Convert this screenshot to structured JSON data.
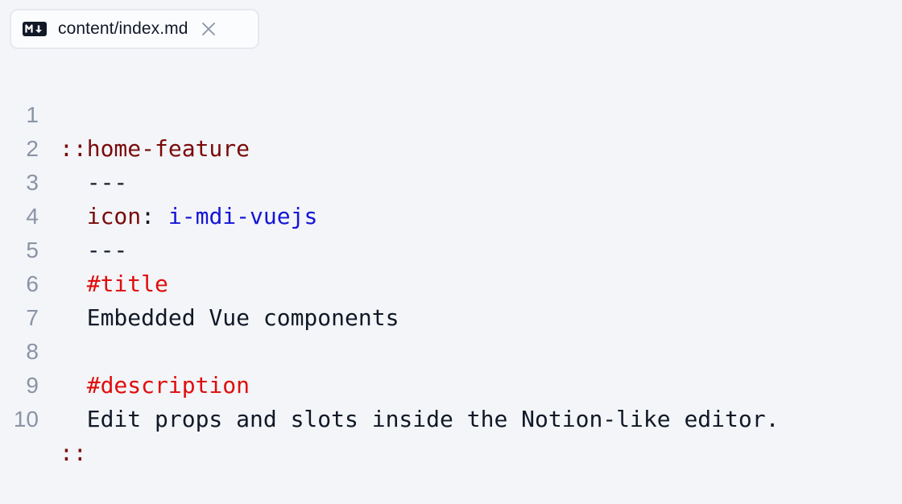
{
  "tab": {
    "filename": "content/index.md",
    "file_icon": "markdown-icon",
    "close_icon": "close-icon"
  },
  "lines": [
    {
      "number": "1",
      "marker": "::",
      "name": "home-feature"
    },
    {
      "number": "2",
      "text": "  ---"
    },
    {
      "number": "3",
      "indent": "  ",
      "key": "icon",
      "colon": ": ",
      "value": "i-mdi-vuejs"
    },
    {
      "number": "4",
      "text": "  ---"
    },
    {
      "number": "5",
      "indent": "  ",
      "slot": "#title"
    },
    {
      "number": "6",
      "text": "  Embedded Vue components"
    },
    {
      "number": "7",
      "text": ""
    },
    {
      "number": "8",
      "indent": "  ",
      "slot": "#description"
    },
    {
      "number": "9",
      "text": "  Edit props and slots inside the Notion-like editor."
    },
    {
      "number": "10",
      "marker": "::"
    }
  ],
  "colors": {
    "background": "#f3f5f8",
    "component": "#7a0a0a",
    "slot": "#e00d0d",
    "value": "#1414d8",
    "text": "#111827",
    "line_number": "#8a94a6"
  }
}
